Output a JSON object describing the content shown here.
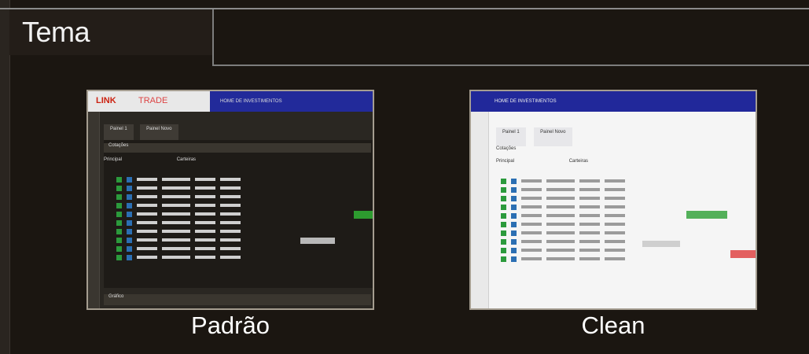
{
  "section": {
    "title": "Tema"
  },
  "themes": [
    {
      "label": "Padrão",
      "preview": {
        "brand_link": "LINK",
        "brand_trade": "TRADE",
        "brand_banner": "HOME DE INVESTIMENTOS",
        "tabs": [
          "Painel 1",
          "Painel Novo"
        ],
        "section": "Cotações",
        "toolbar": [
          "Principal",
          "Carteiras"
        ],
        "bottom": "Gráfico"
      }
    },
    {
      "label": "Clean",
      "preview": {
        "brand_banner": "HOME DE INVESTIMENTOS",
        "tabs": [
          "Painel 1",
          "Painel Novo"
        ],
        "section": "Cotações",
        "toolbar": [
          "Principal",
          "Carteiras"
        ]
      }
    }
  ],
  "colors": {
    "background": "#1b1611",
    "dark_brand_bar": "#222a9a",
    "light_brand_bar": "#21289a",
    "positive": "#2d9b2f",
    "negative": "#e35f5f"
  }
}
